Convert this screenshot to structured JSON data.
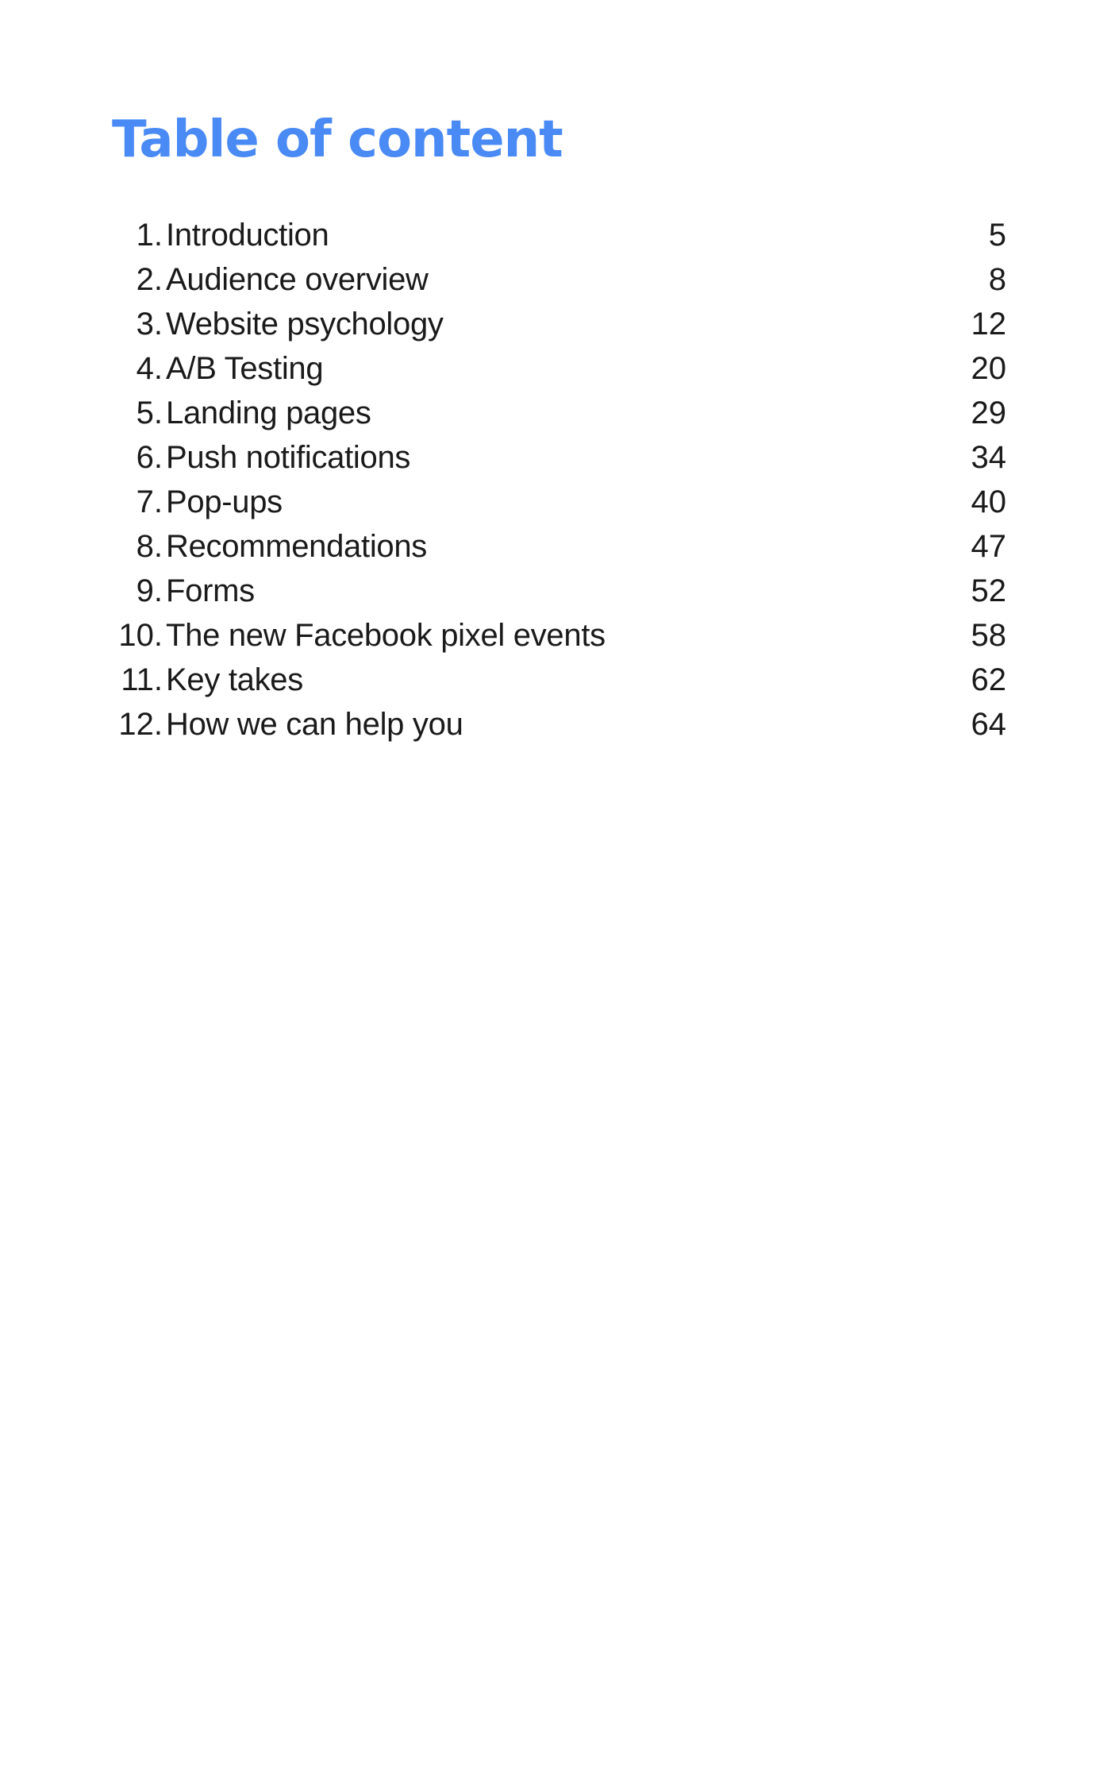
{
  "title": "Table of content",
  "accent_color": "#4a8af4",
  "toc": [
    {
      "num": "1.",
      "label": "Introduction",
      "page": "5"
    },
    {
      "num": "2.",
      "label": "Audience overview",
      "page": "8"
    },
    {
      "num": "3.",
      "label": "Website psychology",
      "page": "12"
    },
    {
      "num": "4.",
      "label": "A/B Testing",
      "page": "20"
    },
    {
      "num": "5.",
      "label": "Landing pages",
      "page": "29"
    },
    {
      "num": "6.",
      "label": "Push notifications",
      "page": "34"
    },
    {
      "num": "7.",
      "label": "Pop-ups",
      "page": "40"
    },
    {
      "num": "8.",
      "label": "Recommendations",
      "page": "47"
    },
    {
      "num": "9.",
      "label": "Forms",
      "page": "52"
    },
    {
      "num": "10.",
      "label": "The new Facebook pixel events",
      "page": "58"
    },
    {
      "num": "11.",
      "label": "Key takes",
      "page": "62"
    },
    {
      "num": "12.",
      "label": "How we can help you",
      "page": "64"
    }
  ]
}
